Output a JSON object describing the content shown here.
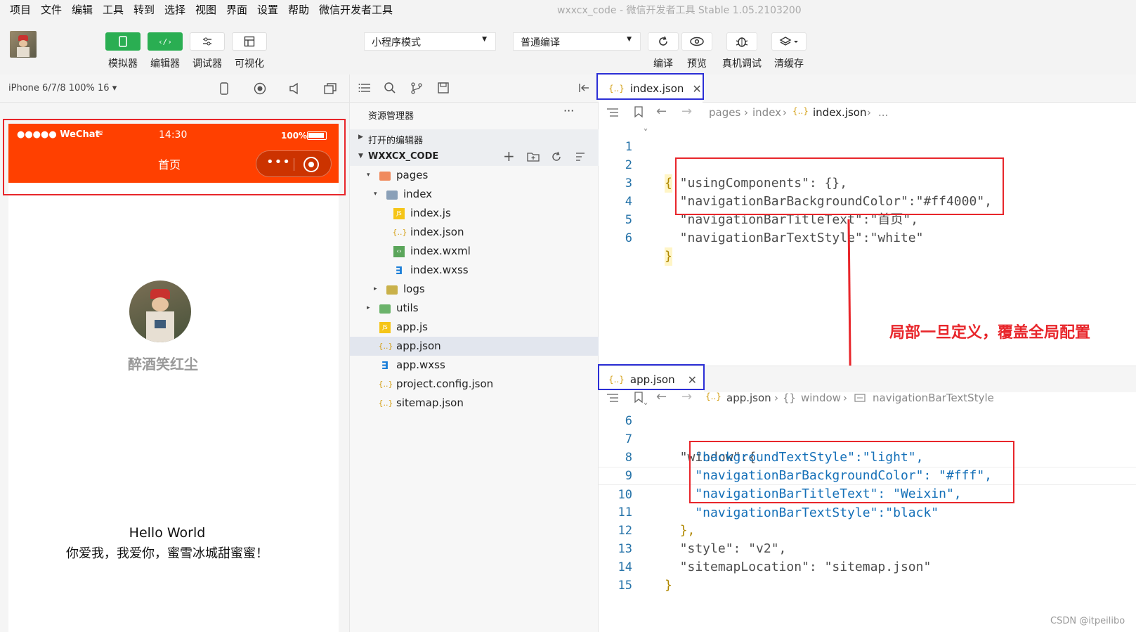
{
  "menu": [
    "项目",
    "文件",
    "编辑",
    "工具",
    "转到",
    "选择",
    "视图",
    "界面",
    "设置",
    "帮助",
    "微信开发者工具"
  ],
  "window_title": "wxxcx_code - 微信开发者工具 Stable 1.05.2103200",
  "toolbar": {
    "mode_buttons": [
      "模拟器",
      "编辑器",
      "调试器",
      "可视化"
    ],
    "mode_select": "小程序模式",
    "compile_select": "普通编译",
    "action_buttons": [
      "编译",
      "预览",
      "真机调试",
      "清缓存"
    ]
  },
  "simulator": {
    "device": "iPhone 6/7/8 100% 16 ▾",
    "status_carrier": "●●●●● WeChat",
    "status_time": "14:30",
    "status_battery": "100%",
    "nav_title": "首页",
    "nav_bg_color": "#ff4000",
    "nickname": "醉酒笑红尘",
    "hello": "Hello World",
    "message": "你爱我，我爱你，蜜雪冰城甜蜜蜜！"
  },
  "explorer": {
    "title": "资源管理器",
    "more": "···",
    "open_editors": "打开的编辑器",
    "project": "WXXCX_CODE",
    "tree": [
      {
        "label": "pages",
        "icon": "folder-pages-icon",
        "arrow": "▾"
      },
      {
        "label": "index",
        "icon": "folder-icon",
        "arrow": "▾"
      },
      {
        "label": "index.js",
        "icon": "js-file-icon",
        "arrow": ""
      },
      {
        "label": "index.json",
        "icon": "json-file-icon",
        "arrow": ""
      },
      {
        "label": "index.wxml",
        "icon": "wxml-file-icon",
        "arrow": ""
      },
      {
        "label": "index.wxss",
        "icon": "css-file-icon",
        "arrow": ""
      },
      {
        "label": "logs",
        "icon": "folder-icon",
        "arrow": "▸"
      },
      {
        "label": "utils",
        "icon": "folder-utils-icon",
        "arrow": "▸"
      },
      {
        "label": "app.js",
        "icon": "js-file-icon",
        "arrow": ""
      },
      {
        "label": "app.json",
        "icon": "json-file-icon",
        "arrow": ""
      },
      {
        "label": "app.wxss",
        "icon": "css-file-icon",
        "arrow": ""
      },
      {
        "label": "project.config.json",
        "icon": "json-file-icon",
        "arrow": ""
      },
      {
        "label": "sitemap.json",
        "icon": "json-file-icon",
        "arrow": ""
      }
    ]
  },
  "editor_top": {
    "tab": "index.json",
    "crumbs": [
      "pages",
      "index",
      "index.json",
      "..."
    ],
    "lines": [
      {
        "n": "1",
        "t": "{"
      },
      {
        "n": "2",
        "t": "  \"usingComponents\": {},"
      },
      {
        "n": "3",
        "t": "  \"navigationBarBackgroundColor\":\"#ff4000\","
      },
      {
        "n": "4",
        "t": "  \"navigationBarTitleText\":\"首页\","
      },
      {
        "n": "5",
        "t": "  \"navigationBarTextStyle\":\"white\""
      },
      {
        "n": "6",
        "t": "}"
      }
    ]
  },
  "editor_bottom": {
    "tab": "app.json",
    "crumbs": [
      "app.json",
      "window",
      "navigationBarTextStyle"
    ],
    "lines": [
      {
        "n": "6",
        "t": "  \"window\":{"
      },
      {
        "n": "7",
        "t": "    \"backgroundTextStyle\":\"light\","
      },
      {
        "n": "8",
        "t": "    \"navigationBarBackgroundColor\": \"#fff\","
      },
      {
        "n": "9",
        "t": "    \"navigationBarTitleText\": \"Weixin\","
      },
      {
        "n": "10",
        "t": "    \"navigationBarTextStyle\":\"black\""
      },
      {
        "n": "11",
        "t": "  },"
      },
      {
        "n": "12",
        "t": "  \"style\": \"v2\","
      },
      {
        "n": "13",
        "t": "  \"sitemapLocation\": \"sitemap.json\""
      },
      {
        "n": "14",
        "t": "}"
      },
      {
        "n": "15",
        "t": ""
      }
    ]
  },
  "annotation": "局部一旦定义，覆盖全局配置",
  "watermark": "CSDN @itpeilibo",
  "colors": {
    "accent_green": "#2aae52",
    "highlight_red": "#e8262b",
    "highlight_blue": "#2c2fd6",
    "nav_orange": "#ff4000"
  }
}
